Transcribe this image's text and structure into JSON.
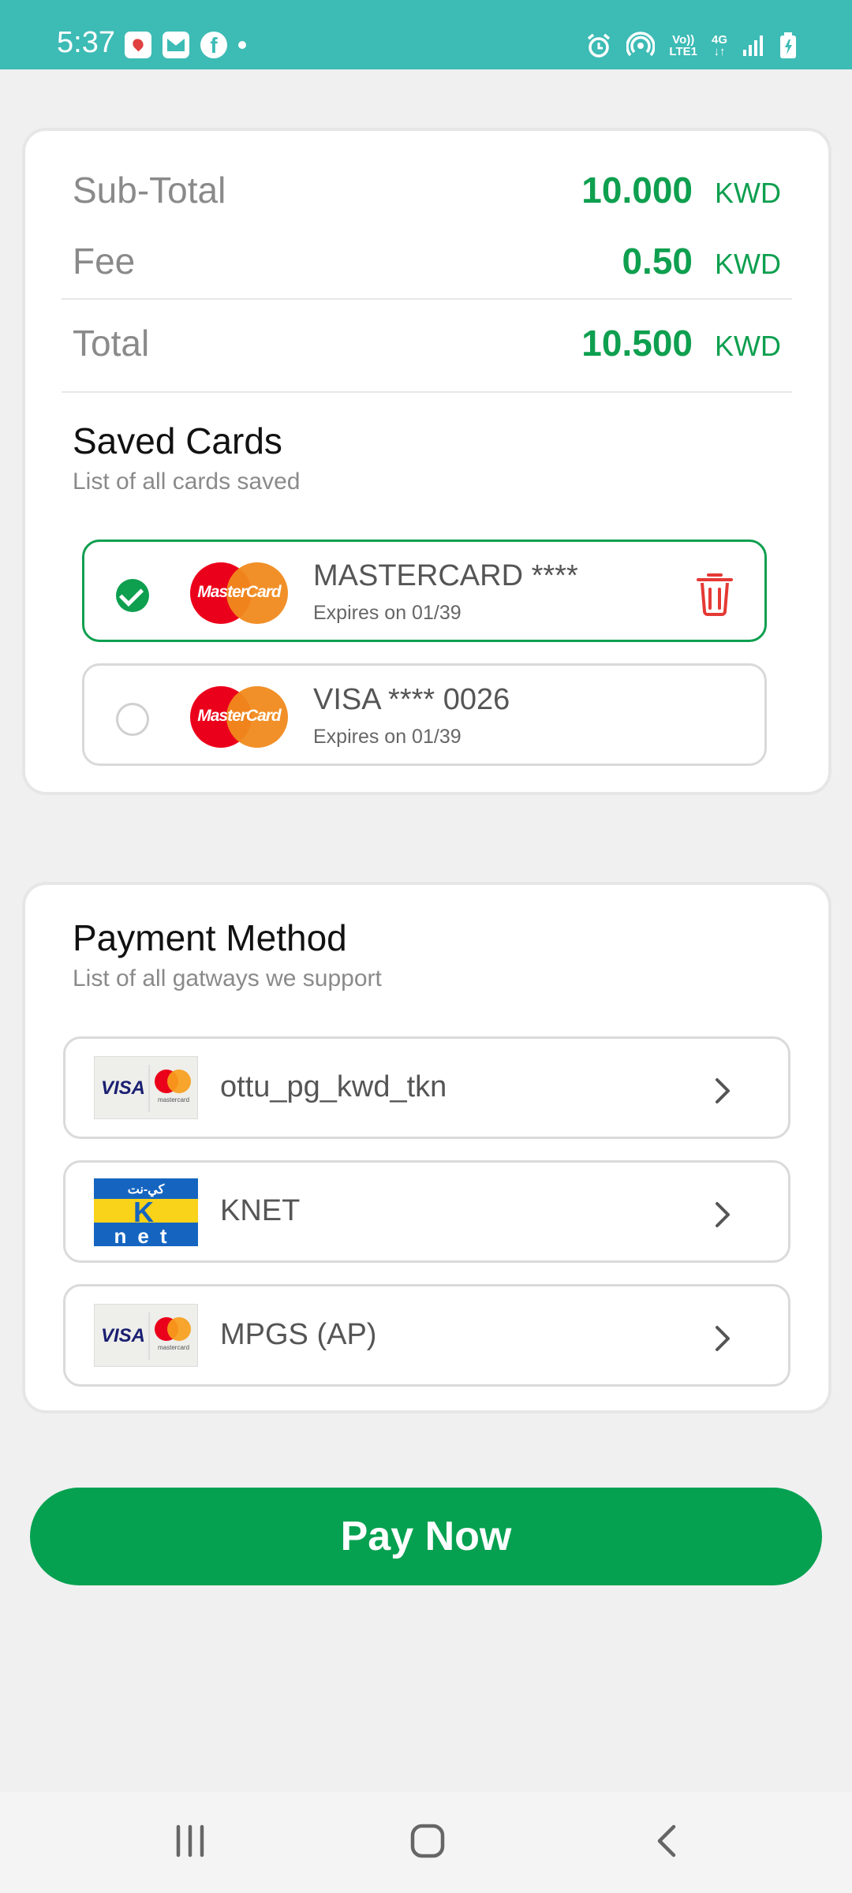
{
  "status_bar": {
    "time": "5:37",
    "network_volte": "Vo))",
    "network_lte": "LTE1",
    "network_type": "4G"
  },
  "summary": {
    "subtotal_label": "Sub-Total",
    "subtotal_value": "10.000",
    "fee_label": "Fee",
    "fee_value": "0.50",
    "total_label": "Total",
    "total_value": "10.500",
    "currency": "KWD"
  },
  "saved_cards": {
    "title": "Saved Cards",
    "subtitle": "List of all cards saved",
    "items": [
      {
        "name": "MASTERCARD ****",
        "expiry": "Expires on  01/39",
        "selected": true,
        "logo_text": "MasterCard"
      },
      {
        "name": "VISA **** 0026",
        "expiry": "Expires on  01/39",
        "selected": false,
        "logo_text": "MasterCard"
      }
    ]
  },
  "payment_method": {
    "title": "Payment Method",
    "subtitle": "List of all gatways we support",
    "items": [
      {
        "name": "ottu_pg_kwd_tkn",
        "logo": "visa-mastercard"
      },
      {
        "name": "KNET",
        "logo": "knet"
      },
      {
        "name": "MPGS (AP)",
        "logo": "visa-mastercard"
      }
    ],
    "logo_visa_text": "VISA",
    "logo_mc_caption": "mastercard",
    "knet_top_text": "كي-نت",
    "knet_k": "K",
    "knet_net": "net"
  },
  "pay_button": {
    "label": "Pay Now"
  },
  "colors": {
    "accent": "#0e9f4f",
    "status_bar": "#3dbbb5",
    "delete": "#e53935"
  },
  "icons": [
    "maps-icon",
    "mail-icon",
    "facebook-icon",
    "alarm-icon",
    "hotspot-icon",
    "signal-icon",
    "battery-icon",
    "check-icon",
    "trash-icon",
    "chevron-right-icon",
    "recents-icon",
    "home-icon",
    "back-icon"
  ]
}
